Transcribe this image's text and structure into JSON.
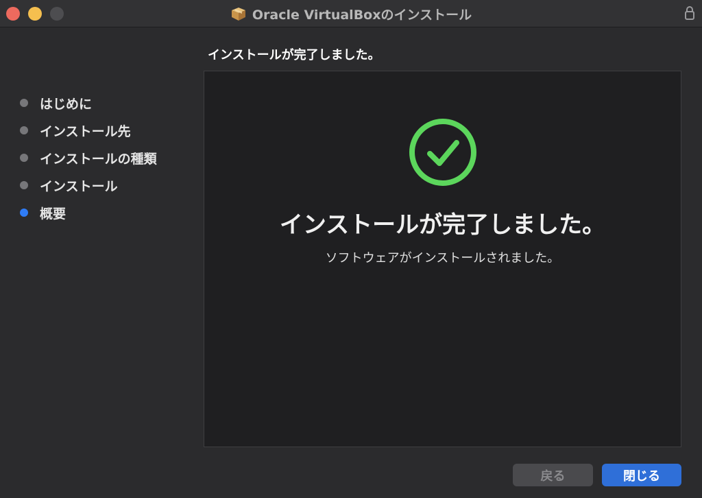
{
  "window": {
    "title": "Oracle VirtualBoxのインストール",
    "icons": {
      "package": "package-icon",
      "lock": "lock-icon"
    }
  },
  "sidebar": {
    "steps": [
      {
        "label": "はじめに",
        "active": false
      },
      {
        "label": "インストール先",
        "active": false
      },
      {
        "label": "インストールの種類",
        "active": false
      },
      {
        "label": "インストール",
        "active": false
      },
      {
        "label": "概要",
        "active": true
      }
    ]
  },
  "main": {
    "heading": "インストールが完了しました。",
    "panel": {
      "icon": "checkmark-circle-icon",
      "title": "インストールが完了しました。",
      "subtitle": "ソフトウェアがインストールされました。"
    }
  },
  "buttons": {
    "back_label": "戻る",
    "close_label": "閉じる"
  },
  "colors": {
    "accent": "#2f7cf6",
    "success": "#5cd65c",
    "close_button": "#2f6fd8"
  }
}
